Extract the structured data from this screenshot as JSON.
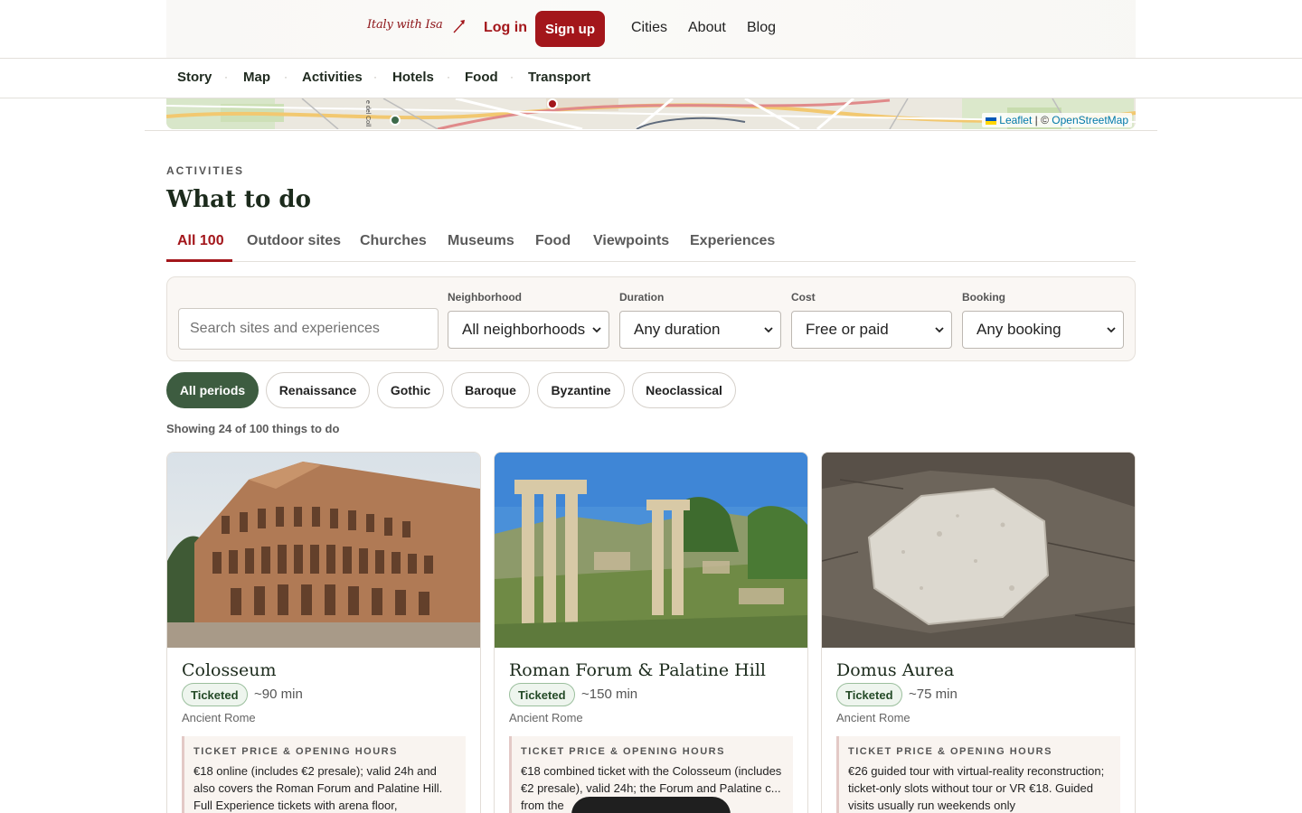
{
  "header": {
    "logo_text": "Italy with Isa",
    "login_label": "Log in",
    "signup_label": "Sign up",
    "nav": [
      "Cities",
      "About",
      "Blog"
    ]
  },
  "subnav": [
    "Story",
    "Map",
    "Activities",
    "Hotels",
    "Food",
    "Transport"
  ],
  "map": {
    "attribution_leaflet": "Leaflet",
    "attribution_sep": "| ©",
    "attribution_osm": "OpenStreetMap",
    "street_label": "e del Coll"
  },
  "section": {
    "eyebrow": "ACTIVITIES",
    "title": "What to do"
  },
  "tabs": [
    "All 100",
    "Outdoor sites",
    "Churches",
    "Museums",
    "Food",
    "Viewpoints",
    "Experiences"
  ],
  "filters": {
    "search_placeholder": "Search sites and experiences",
    "neighborhood_label": "Neighborhood",
    "neighborhood_value": "All neighborhoods",
    "duration_label": "Duration",
    "duration_value": "Any duration",
    "cost_label": "Cost",
    "cost_value": "Free or paid",
    "booking_label": "Booking",
    "booking_value": "Any booking"
  },
  "periods": [
    "All periods",
    "Renaissance",
    "Gothic",
    "Baroque",
    "Byzantine",
    "Neoclassical"
  ],
  "showing_text": "Showing 24 of 100 things to do",
  "cards": [
    {
      "title": "Colosseum",
      "badge": "Ticketed",
      "duration": "~90 min",
      "neighborhood": "Ancient Rome",
      "ticket_heading": "TICKET PRICE & OPENING HOURS",
      "ticket_text": "€18 online (includes €2 presale); valid 24h and also covers the Roman Forum and Palatine Hill. Full Experience tickets with arena floor,"
    },
    {
      "title": "Roman Forum & Palatine Hill",
      "badge": "Ticketed",
      "duration": "~150 min",
      "neighborhood": "Ancient Rome",
      "ticket_heading": "TICKET PRICE & OPENING HOURS",
      "ticket_text": "€18 combined ticket with the Colosseum (includes €2 presale), valid 24h; the Forum and Palatine c... from the"
    },
    {
      "title": "Domus Aurea",
      "badge": "Ticketed",
      "duration": "~75 min",
      "neighborhood": "Ancient Rome",
      "ticket_heading": "TICKET PRICE & OPENING HOURS",
      "ticket_text": "€26 guided tour with virtual-reality reconstruction; ticket-only slots without tour or VR €18. Guided visits usually run weekends only"
    }
  ],
  "colors": {
    "brand_red": "#a3161b",
    "period_active": "#3d5c40",
    "heading_green": "#1c2b1c"
  }
}
